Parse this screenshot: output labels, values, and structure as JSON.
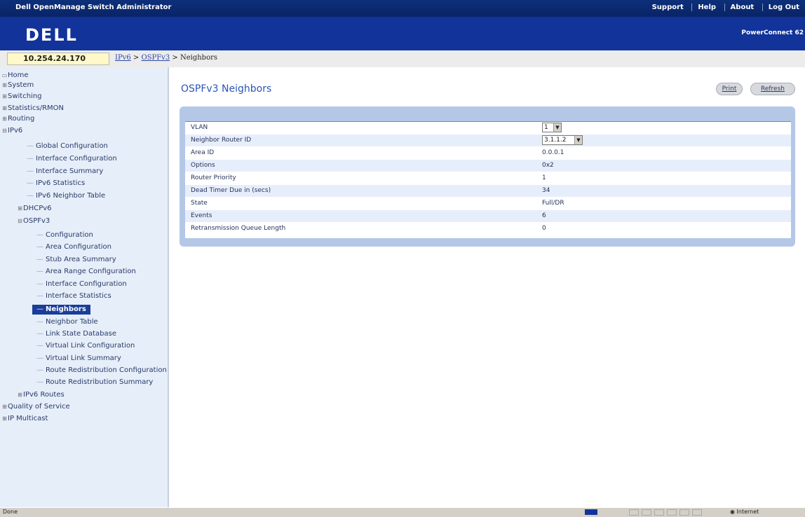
{
  "window": {
    "app_title": "Dell OpenManage Switch Administrator",
    "top_links": [
      "Support",
      "Help",
      "About",
      "Log Out"
    ],
    "logo": "DELL",
    "product": "PowerConnect 62"
  },
  "address": {
    "ip": "10.254.24.170",
    "breadcrumb": [
      "IPv6",
      "OSPFv3",
      "Neighbors"
    ],
    "separator": ">"
  },
  "sidebar": {
    "items": [
      {
        "label": "Home",
        "level": 0,
        "icon": "folder-icon"
      },
      {
        "label": "System",
        "level": 0,
        "icon": "expand-icon"
      },
      {
        "label": "Switching",
        "level": 0,
        "icon": "expand-icon"
      },
      {
        "label": "Statistics/RMON",
        "level": 0,
        "icon": "expand-icon"
      },
      {
        "label": "Routing",
        "level": 0,
        "icon": "expand-icon"
      },
      {
        "label": "IPv6",
        "level": 0,
        "icon": "collapse-icon"
      },
      {
        "label": "Global Configuration",
        "level": 1,
        "icon": "branch-icon"
      },
      {
        "label": "Interface Configuration",
        "level": 1,
        "icon": "branch-icon"
      },
      {
        "label": "Interface Summary",
        "level": 1,
        "icon": "branch-icon"
      },
      {
        "label": "IPv6 Statistics",
        "level": 1,
        "icon": "branch-icon"
      },
      {
        "label": "IPv6 Neighbor Table",
        "level": 1,
        "icon": "branch-icon"
      },
      {
        "label": "DHCPv6",
        "level": 1,
        "icon": "expand-icon"
      },
      {
        "label": "OSPFv3",
        "level": 1,
        "icon": "collapse-icon"
      },
      {
        "label": "Configuration",
        "level": 2,
        "icon": "branch-icon"
      },
      {
        "label": "Area Configuration",
        "level": 2,
        "icon": "branch-icon"
      },
      {
        "label": "Stub Area Summary",
        "level": 2,
        "icon": "branch-icon"
      },
      {
        "label": "Area Range Configuration",
        "level": 2,
        "icon": "branch-icon"
      },
      {
        "label": "Interface Configuration",
        "level": 2,
        "icon": "branch-icon"
      },
      {
        "label": "Interface Statistics",
        "level": 2,
        "icon": "branch-icon"
      },
      {
        "label": "Neighbors",
        "level": 2,
        "icon": "branch-icon",
        "selected": true
      },
      {
        "label": "Neighbor Table",
        "level": 2,
        "icon": "branch-icon"
      },
      {
        "label": "Link State Database",
        "level": 2,
        "icon": "branch-icon"
      },
      {
        "label": "Virtual Link Configuration",
        "level": 2,
        "icon": "branch-icon"
      },
      {
        "label": "Virtual Link Summary",
        "level": 2,
        "icon": "branch-icon"
      },
      {
        "label": "Route Redistribution Configuration",
        "level": 2,
        "icon": "branch-icon"
      },
      {
        "label": "Route Redistribution Summary",
        "level": 2,
        "icon": "branch-icon"
      },
      {
        "label": "IPv6 Routes",
        "level": 1,
        "icon": "expand-icon"
      },
      {
        "label": "Quality of Service",
        "level": 0,
        "icon": "expand-icon"
      },
      {
        "label": "IP Multicast",
        "level": 0,
        "icon": "expand-icon"
      }
    ]
  },
  "main": {
    "title": "OSPFv3 Neighbors",
    "buttons": {
      "print": "Print",
      "refresh": "Refresh"
    },
    "rows": [
      {
        "label": "VLAN",
        "value": "1",
        "control": "select"
      },
      {
        "label": "Neighbor Router ID",
        "value": "3.1.1.2",
        "control": "select"
      },
      {
        "label": "Area ID",
        "value": "0.0.0.1",
        "control": "text"
      },
      {
        "label": "Options",
        "value": "0x2",
        "control": "text"
      },
      {
        "label": "Router Priority",
        "value": "1",
        "control": "text"
      },
      {
        "label": "Dead Timer Due in (secs)",
        "value": "34",
        "control": "text"
      },
      {
        "label": "State",
        "value": "Full/DR",
        "control": "text"
      },
      {
        "label": "Events",
        "value": "6",
        "control": "text"
      },
      {
        "label": "Retransmission Queue Length",
        "value": "0",
        "control": "text"
      }
    ]
  },
  "status_bar": {
    "left": "Done",
    "right": "Internet",
    "icon": "globe-icon"
  }
}
